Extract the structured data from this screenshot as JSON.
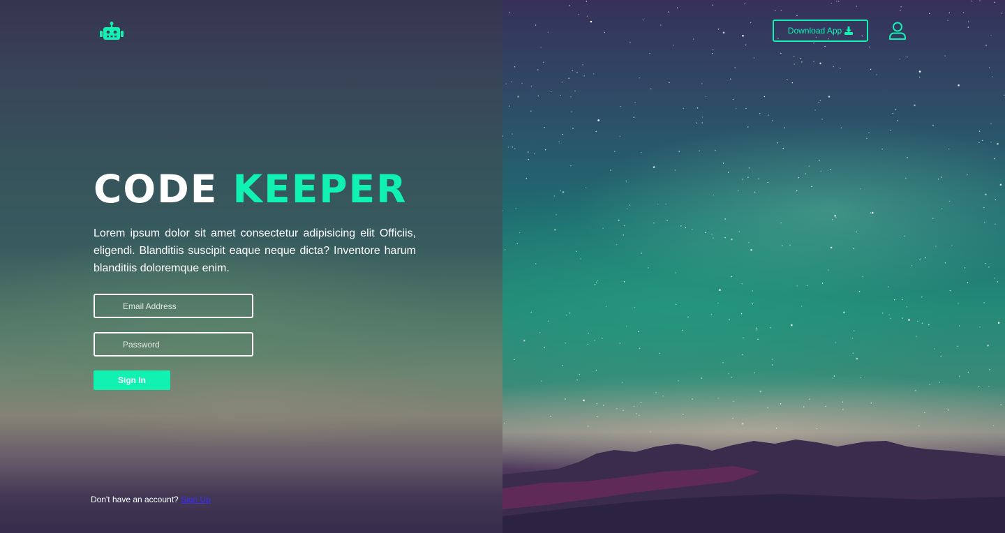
{
  "brand": {
    "logo_icon": "robot-icon",
    "accent_color": "#11f1b2"
  },
  "header": {
    "download_label": "Download App",
    "download_icon": "download-icon",
    "user_icon": "user-icon"
  },
  "hero": {
    "title_part1": "CODE",
    "title_part2": "KEEPER",
    "description": "Lorem ipsum dolor sit amet consectetur adipisicing elit Officiis, eligendi. Blanditiis suscipit eaque neque dicta? Inventore harum blanditiis doloremque enim."
  },
  "form": {
    "email_placeholder": "Email Address",
    "password_placeholder": "Password",
    "signin_label": "Sign In"
  },
  "footer": {
    "prompt_text": "Don't have an account?",
    "signup_link": "Sign Up"
  }
}
